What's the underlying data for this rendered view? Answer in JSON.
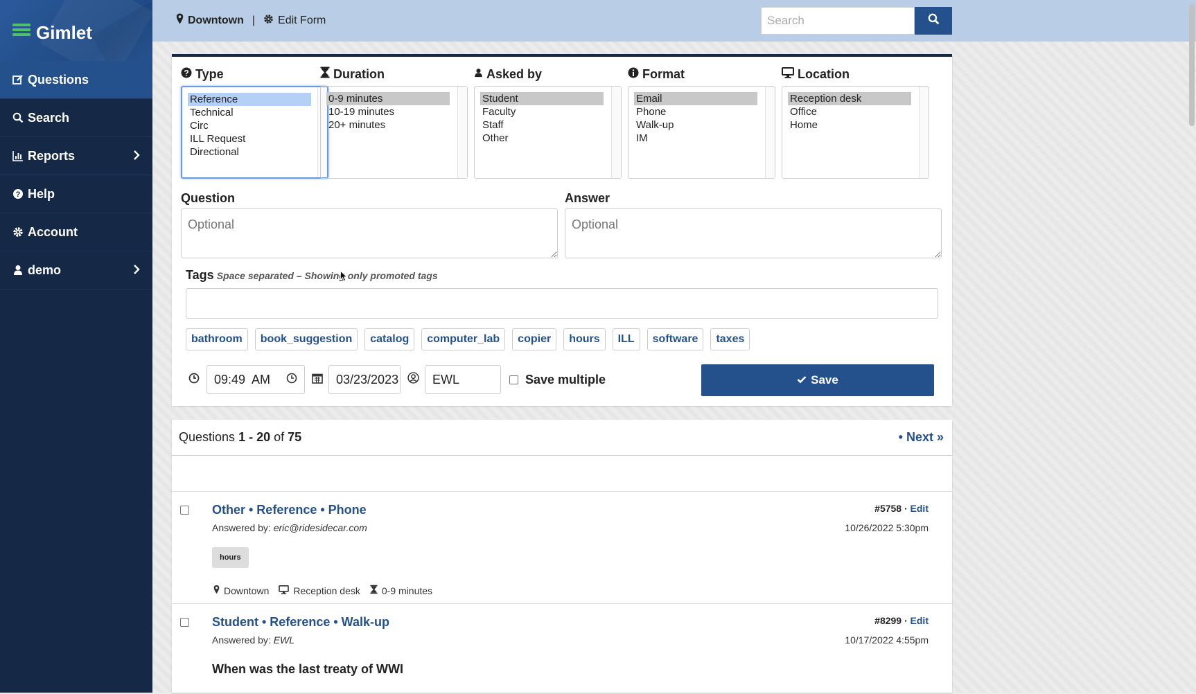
{
  "app": {
    "name": "Gimlet"
  },
  "sidebar": {
    "items": [
      {
        "label": "Questions",
        "icon": "edit-icon",
        "active": true
      },
      {
        "label": "Search",
        "icon": "search-icon"
      },
      {
        "label": "Reports",
        "icon": "bar-chart-icon",
        "chevron": true
      },
      {
        "label": "Help",
        "icon": "question-circle-icon"
      },
      {
        "label": "Account",
        "icon": "gear-icon"
      },
      {
        "label": "demo",
        "icon": "user-icon",
        "chevron": true
      }
    ]
  },
  "topbar": {
    "location": "Downtown",
    "separator": "|",
    "edit_form": "Edit Form",
    "search_placeholder": "Search"
  },
  "form": {
    "type": {
      "label": "Type",
      "options": [
        "Reference",
        "Technical",
        "Circ",
        "ILL Request",
        "Directional"
      ],
      "selected": "Reference"
    },
    "duration": {
      "label": "Duration",
      "options": [
        "0-9 minutes",
        "10-19 minutes",
        "20+ minutes"
      ],
      "selected": "0-9 minutes"
    },
    "asked_by": {
      "label": "Asked by",
      "options": [
        "Student",
        "Faculty",
        "Staff",
        "Other"
      ],
      "selected": "Student"
    },
    "format": {
      "label": "Format",
      "options": [
        "Email",
        "Phone",
        "Walk-up",
        "IM"
      ],
      "selected": "Email"
    },
    "location": {
      "label": "Location",
      "options": [
        "Reception desk",
        "Office",
        "Home"
      ],
      "selected": "Reception desk"
    },
    "question": {
      "label": "Question",
      "placeholder": "Optional"
    },
    "answer": {
      "label": "Answer",
      "placeholder": "Optional"
    },
    "tags": {
      "label": "Tags",
      "hint": "Space separated – Showing only promoted tags",
      "promoted": [
        "bathroom",
        "book_suggestion",
        "catalog",
        "computer_lab",
        "copier",
        "hours",
        "ILL",
        "software",
        "taxes"
      ]
    },
    "time": "09:49  AM",
    "date": "03/23/2023",
    "initials": "EWL",
    "save_multiple_label": "Save multiple",
    "save_label": "Save"
  },
  "list": {
    "summary_prefix": "Questions",
    "range": "1 - 20",
    "of_label": "of",
    "total": "75",
    "next_bullet": "•",
    "next_label": "Next »",
    "entries": [
      {
        "title": "Other • Reference • Phone",
        "answered_by_label": "Answered by:",
        "answered_by": "eric@ridesidecar.com",
        "id": "#5758",
        "dot": "·",
        "edit_label": "Edit",
        "date": "10/26/2022 5:30pm",
        "tag": "hours",
        "meta_location": "Downtown",
        "meta_desk": "Reception desk",
        "meta_duration": "0-9 minutes"
      },
      {
        "title": "Student • Reference • Walk-up",
        "answered_by_label": "Answered by:",
        "answered_by": "EWL",
        "id": "#8299",
        "dot": "·",
        "edit_label": "Edit",
        "date": "10/17/2022 4:55pm",
        "question": "When was the last treaty of WWI"
      }
    ]
  },
  "colors": {
    "navy": "#152947",
    "primary": "#24508c",
    "topbar": "#b9cde6",
    "accent_green": "#4fc16b"
  }
}
